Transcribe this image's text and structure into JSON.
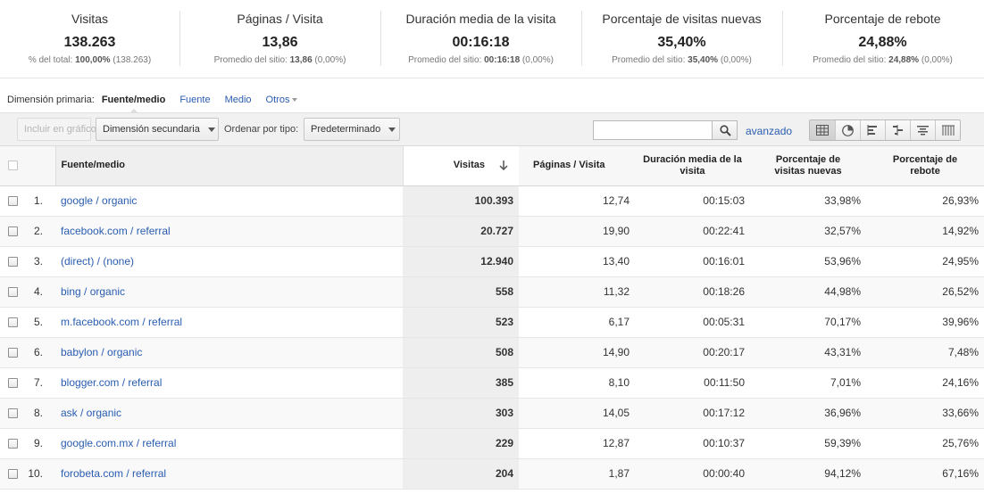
{
  "summary": [
    {
      "name": "Visitas",
      "value": "138.263",
      "sub_label": "% del total:",
      "sub_value": "100,00%",
      "sub_extra": "(138.263)"
    },
    {
      "name": "Páginas / Visita",
      "value": "13,86",
      "sub_label": "Promedio del sitio:",
      "sub_value": "13,86",
      "sub_extra": "(0,00%)"
    },
    {
      "name": "Duración media de la visita",
      "value": "00:16:18",
      "sub_label": "Promedio del sitio:",
      "sub_value": "00:16:18",
      "sub_extra": "(0,00%)"
    },
    {
      "name": "Porcentaje de visitas nuevas",
      "value": "35,40%",
      "sub_label": "Promedio del sitio:",
      "sub_value": "35,40%",
      "sub_extra": "(0,00%)"
    },
    {
      "name": "Porcentaje de rebote",
      "value": "24,88%",
      "sub_label": "Promedio del sitio:",
      "sub_value": "24,88%",
      "sub_extra": "(0,00%)"
    }
  ],
  "primary_dimension": {
    "label": "Dimensión primaria:",
    "active": "Fuente/medio",
    "options": [
      "Fuente",
      "Medio"
    ],
    "more": "Otros"
  },
  "toolbar": {
    "include_in_chart": "Incluir en gráfico",
    "secondary_dimension": "Dimensión secundaria",
    "sort_label": "Ordenar por tipo:",
    "sort_value": "Predeterminado",
    "search_value": "",
    "advanced": "avanzado",
    "icons": [
      "table-view-icon",
      "pie-view-icon",
      "bar-view-icon",
      "comparison-view-icon",
      "term-cloud-icon",
      "pivot-view-icon"
    ]
  },
  "table": {
    "headers": {
      "dimension": "Fuente/medio",
      "visits": "Visitas",
      "pages": "Páginas / Visita",
      "duration_l1": "Duración media de la",
      "duration_l2": "visita",
      "new_l1": "Porcentaje de",
      "new_l2": "visitas nuevas",
      "bounce_l1": "Porcentaje de",
      "bounce_l2": "rebote"
    },
    "rows": [
      {
        "idx": "1.",
        "source": "google / organic",
        "visits": "100.393",
        "pages": "12,74",
        "duration": "00:15:03",
        "new": "33,98%",
        "bounce": "26,93%"
      },
      {
        "idx": "2.",
        "source": "facebook.com / referral",
        "visits": "20.727",
        "pages": "19,90",
        "duration": "00:22:41",
        "new": "32,57%",
        "bounce": "14,92%"
      },
      {
        "idx": "3.",
        "source": "(direct) / (none)",
        "visits": "12.940",
        "pages": "13,40",
        "duration": "00:16:01",
        "new": "53,96%",
        "bounce": "24,95%"
      },
      {
        "idx": "4.",
        "source": "bing / organic",
        "visits": "558",
        "pages": "11,32",
        "duration": "00:18:26",
        "new": "44,98%",
        "bounce": "26,52%"
      },
      {
        "idx": "5.",
        "source": "m.facebook.com / referral",
        "visits": "523",
        "pages": "6,17",
        "duration": "00:05:31",
        "new": "70,17%",
        "bounce": "39,96%"
      },
      {
        "idx": "6.",
        "source": "babylon / organic",
        "visits": "508",
        "pages": "14,90",
        "duration": "00:20:17",
        "new": "43,31%",
        "bounce": "7,48%"
      },
      {
        "idx": "7.",
        "source": "blogger.com / referral",
        "visits": "385",
        "pages": "8,10",
        "duration": "00:11:50",
        "new": "7,01%",
        "bounce": "24,16%"
      },
      {
        "idx": "8.",
        "source": "ask / organic",
        "visits": "303",
        "pages": "14,05",
        "duration": "00:17:12",
        "new": "36,96%",
        "bounce": "33,66%"
      },
      {
        "idx": "9.",
        "source": "google.com.mx / referral",
        "visits": "229",
        "pages": "12,87",
        "duration": "00:10:37",
        "new": "59,39%",
        "bounce": "25,76%"
      },
      {
        "idx": "10.",
        "source": "forobeta.com / referral",
        "visits": "204",
        "pages": "1,87",
        "duration": "00:00:40",
        "new": "94,12%",
        "bounce": "67,16%"
      }
    ]
  }
}
